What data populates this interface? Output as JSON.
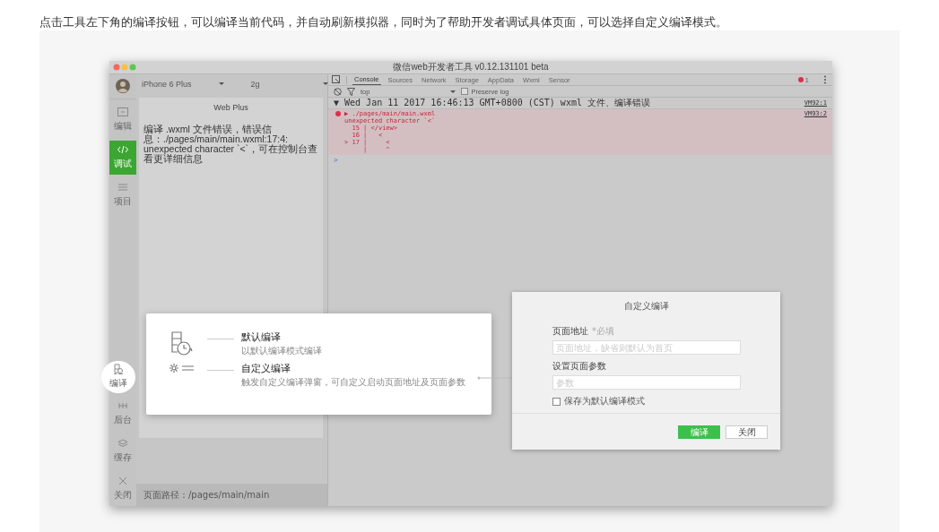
{
  "intro": "点击工具左下角的编译按钮，可以编译当前代码，并自动刷新模拟器，同时为了帮助开发者调试具体页面，可以选择自定义编译模式。",
  "window": {
    "title": "微信web开发者工具 v0.12.131101 beta"
  },
  "sidebar": {
    "items": [
      {
        "label": "编辑",
        "kind": "editor",
        "selected": false,
        "highlighted": false
      },
      {
        "label": "调试",
        "kind": "debug",
        "selected": true,
        "highlighted": false
      },
      {
        "label": "项目",
        "kind": "project",
        "selected": false,
        "highlighted": false
      },
      {
        "label": "编译",
        "kind": "compile",
        "selected": false,
        "highlighted": true
      },
      {
        "label": "后台",
        "kind": "backend",
        "selected": false,
        "highlighted": false
      },
      {
        "label": "缓存",
        "kind": "cache",
        "selected": false,
        "highlighted": false
      },
      {
        "label": "关闭",
        "kind": "close",
        "selected": false,
        "highlighted": false
      }
    ]
  },
  "simulator": {
    "device": "iPhone 6 Plus",
    "network": "2g",
    "page_title": "Web Plus",
    "message": "编译 .wxml 文件错误，错误信息：./pages/main/main.wxml:17:4: unexpected character `<`，可在控制台查看更详细信息",
    "path": "页面路径：/pages/main/main"
  },
  "devtools": {
    "tabs": [
      {
        "label": "Console",
        "selected": true
      },
      {
        "label": "Sources",
        "selected": false
      },
      {
        "label": "Network",
        "selected": false
      },
      {
        "label": "Storage",
        "selected": false
      },
      {
        "label": "AppData",
        "selected": false
      },
      {
        "label": "Wxml",
        "selected": false
      },
      {
        "label": "Sensor",
        "selected": false
      }
    ],
    "error_count": "1",
    "context": "top",
    "preserve_log": {
      "label": "Preserve log",
      "checked": false
    },
    "log": {
      "header": "▼ Wed Jan 11 2017 16:46:13 GMT+0800 (CST) wxml 文件、编译错误",
      "header_source": "VM92:1",
      "file": "▶ ./pages/main/main.wxml",
      "source": "VM93:2",
      "lines": [
        "unexpected character `<`",
        "  15 | </view>",
        "  16 |   <",
        "> 17 |     <",
        "     |     ^"
      ]
    },
    "prompt": ">"
  },
  "compile_menu": {
    "options": [
      {
        "kind": "default",
        "title": "默认编译",
        "description": "以默认编译模式编译"
      },
      {
        "kind": "custom",
        "title": "自定义编译",
        "description": "触发自定义编译弹窗，可自定义启动页面地址及页面参数"
      }
    ]
  },
  "dialog": {
    "title": "自定义编译",
    "fields": [
      {
        "label": "页面地址",
        "hint": "*必填",
        "placeholder": "页面地址，缺省则默认为首页"
      },
      {
        "label": "设置页面参数",
        "placeholder": "参数"
      }
    ],
    "checkbox": {
      "label": "保存为默认编译模式",
      "checked": false
    },
    "buttons": [
      {
        "label": "编译",
        "kind": "primary"
      },
      {
        "label": "关闭",
        "kind": "secondary"
      }
    ]
  }
}
